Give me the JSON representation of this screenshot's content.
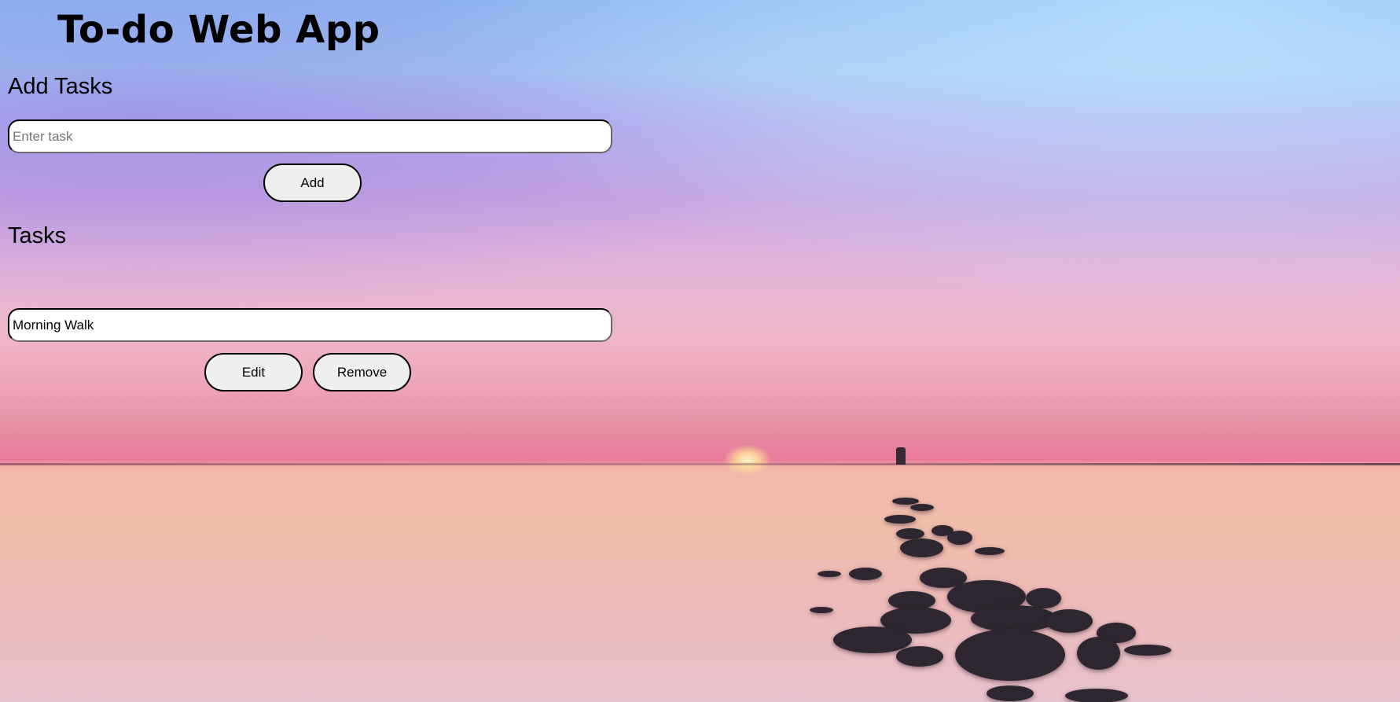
{
  "app": {
    "title": "To-do Web App"
  },
  "add_section": {
    "heading": "Add Tasks",
    "input_placeholder": "Enter task",
    "input_value": "",
    "add_button_label": "Add"
  },
  "tasks_section": {
    "heading": "Tasks",
    "items": [
      {
        "text": "Morning Walk",
        "edit_label": "Edit",
        "remove_label": "Remove"
      }
    ]
  },
  "background": {
    "scene": "sunset-over-sea-with-rocks",
    "colors": {
      "sky_top": "#8fb8f2",
      "sky_mid": "#c9a6e2",
      "horizon": "#e9799a",
      "water": "#f2bda8",
      "button_fill": "#efefef",
      "border": "#000000"
    }
  }
}
